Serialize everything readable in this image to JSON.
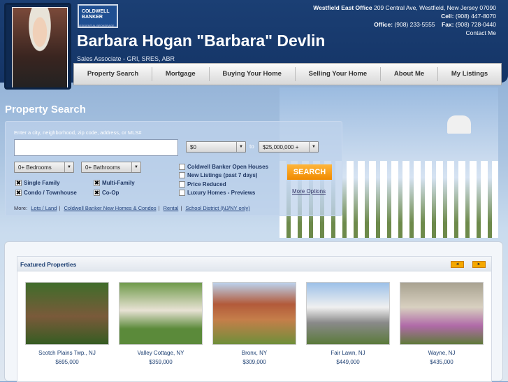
{
  "header": {
    "logo_text": "COLDWELL BANKER",
    "logo_sub": "RESIDENTIAL BROKERAGE",
    "agent_name": "Barbara Hogan \"Barbara\" Devlin",
    "agent_title": "Sales Associate - GRI, SRES, ABR",
    "office_label": "Westfield East Office",
    "office_address": "209 Central Ave, Westfield, New Jersey 07090",
    "cell_label": "Cell:",
    "cell": "(908) 447-8070",
    "office_phone_label": "Office:",
    "office_phone": "(908) 233-5555",
    "fax_label": "Fax:",
    "fax": "(908) 728-0440",
    "contact_link": "Contact Me"
  },
  "nav": [
    "Property Search",
    "Mortgage",
    "Buying Your Home",
    "Selling Your Home",
    "About Me",
    "My Listings"
  ],
  "search": {
    "title": "Property Search",
    "hint": "Enter a city, neighborhood, zip code, address, or MLS#",
    "query": "",
    "min_price": "$0",
    "to": "to",
    "max_price": "$25,000,000 +",
    "bedrooms": "0+ Bedrooms",
    "bathrooms": "0+ Bathrooms",
    "types": [
      {
        "label": "Single Family",
        "checked": true
      },
      {
        "label": "Multi-Family",
        "checked": true
      },
      {
        "label": "Condo / Townhouse",
        "checked": true
      },
      {
        "label": "Co-Op",
        "checked": true
      }
    ],
    "filters": [
      "Coldwell Banker Open Houses",
      "New Listings (past 7 days)",
      "Price Reduced",
      "Luxury Homes - Previews"
    ],
    "search_button": "SEARCH",
    "more_options": "More Options",
    "more_label": "More:",
    "more_links": [
      "Lots / Land",
      "Coldwell Banker New Homes & Condos",
      "Rental",
      "School District (NJ/NY only)"
    ]
  },
  "featured": {
    "title": "Featured Properties",
    "prev": "◄",
    "next": "►",
    "properties": [
      {
        "location": "Scotch Plains Twp., NJ",
        "price": "$695,000"
      },
      {
        "location": "Valley Cottage, NY",
        "price": "$359,000"
      },
      {
        "location": "Bronx, NY",
        "price": "$309,000"
      },
      {
        "location": "Fair Lawn, NJ",
        "price": "$449,000"
      },
      {
        "location": "Wayne, NJ",
        "price": "$435,000"
      }
    ]
  }
}
